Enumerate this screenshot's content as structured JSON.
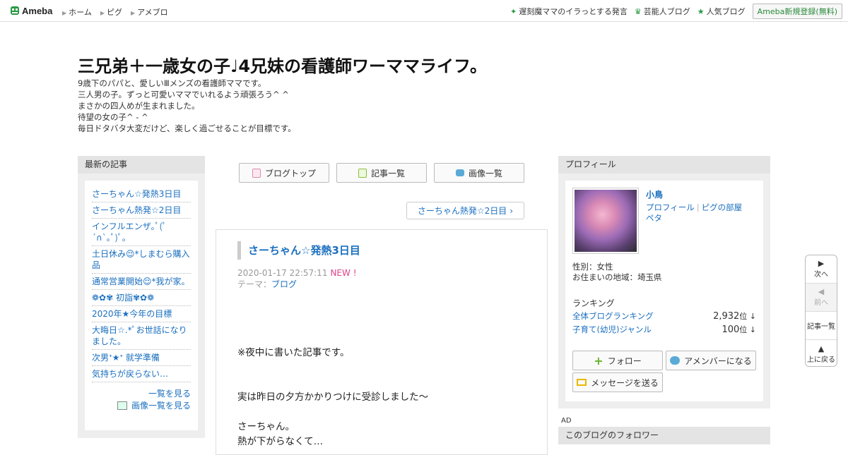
{
  "topbar": {
    "logo": "Ameba",
    "nav": [
      "ホーム",
      "ピグ",
      "アメブロ"
    ],
    "right_links": [
      {
        "icon": "sparkle-icon",
        "label": "遅刻魔ママのイラっとする発言"
      },
      {
        "icon": "crown-icon",
        "label": "芸能人ブログ"
      },
      {
        "icon": "star-icon",
        "label": "人気ブログ"
      }
    ],
    "register": "Ameba新規登録(無料)"
  },
  "header": {
    "title": "三兄弟＋一歳女の子♩4兄妹の看護師ワーママライフ。",
    "description": [
      "9歳下のパパと、愛しいⅢメンズの看護師ママです。",
      "三人男の子。ずっと可愛いママでいれるよう頑張ろう^ ^",
      "まさかの四人めが生まれました。",
      "待望の女の子^ - ^",
      "毎日ドタバタ大変だけど、楽しく過ごせることが目標です。"
    ]
  },
  "left_sidebar": {
    "heading": "最新の記事",
    "entries": [
      "さーちゃん☆発熱3日目",
      "さーちゃん熱発☆2日目",
      "インフルエンザ｡ﾟ(ﾟ´∩`｡ﾟ)ﾟ｡",
      "土日休み😌*しまむら購入品",
      "通常営業開始😌*我が家。",
      "❁✿✾ 初詣✾✿❁",
      "2020年★今年の目標",
      "大晦日☆.*ﾟお世話になりました。",
      "次男ᐩ★ᐩ 就学準備",
      "気持ちが戻らない…"
    ],
    "more": "一覧を見る",
    "image_list": "画像一覧を見る"
  },
  "tabs": {
    "top": "ブログトップ",
    "list": "記事一覧",
    "images": "画像一覧"
  },
  "next_entry": "さーちゃん熱発☆2日目",
  "article": {
    "title": "さーちゃん☆発熱3日目",
    "datetime": "2020-01-17 22:57:11",
    "new_badge": "NEW !",
    "theme_label": "テーマ：",
    "theme": "ブログ",
    "body": [
      "※夜中に書いた記事です。",
      "",
      "",
      "実は昨日の夕方かかりつけに受診しました〜",
      "",
      "さーちゃん。",
      "熱が下がらなくて…"
    ]
  },
  "profile": {
    "heading": "プロフィール",
    "name": "小鳥",
    "links": [
      "プロフィール",
      "ピグの部屋",
      "ペタ"
    ],
    "gender": "性別：女性",
    "region": "お住まいの地域：埼玉県",
    "ranking_heading": "ランキング",
    "rankings": [
      {
        "label": "全体ブログランキング",
        "value": "2,932",
        "unit": "位 ↓"
      },
      {
        "label": "子育て(幼児)ジャンル",
        "value": "100",
        "unit": "位 ↓"
      }
    ],
    "follow": "フォロー",
    "amember": "アメンバーになる",
    "message": "メッセージを送る"
  },
  "ad_label": "AD",
  "followers_heading": "このブログのフォロワー",
  "floatnav": {
    "next": "次へ",
    "prev": "前へ",
    "list": "記事一覧",
    "top": "上に戻る"
  },
  "colors": {
    "link": "#1a6fbf",
    "brand_green": "#2a9a44",
    "new_badge": "#e0408a"
  }
}
